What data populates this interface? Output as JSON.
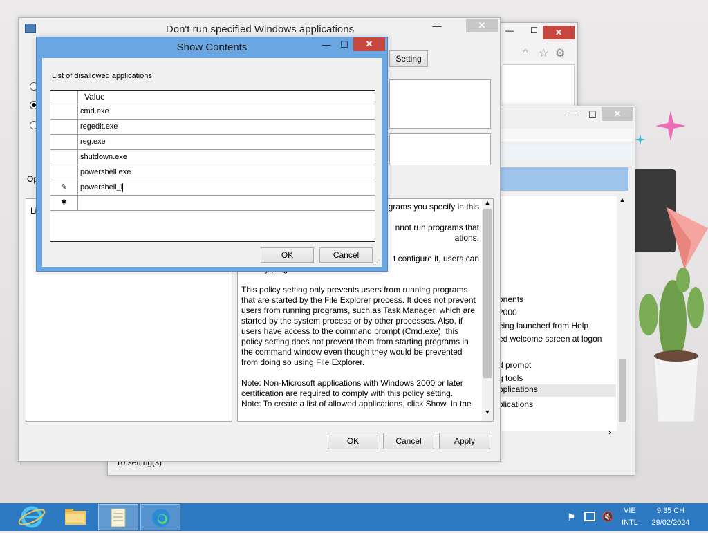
{
  "main_dialog": {
    "title": "Don't run specified Windows applications",
    "setting_button": "Setting",
    "options_label": "Op",
    "list_label_fragment": "Li",
    "help_text_lines": [
      "rograms you specify in this",
      "",
      "nnot run programs that",
      "ations.",
      "",
      "t configure it, users can",
      "run any programs.",
      "",
      "This policy setting only prevents users from running programs",
      "that are started by the File Explorer process. It does not prevent",
      "users from running programs, such as Task Manager, which are",
      "started by the system process or by other processes.  Also, if",
      "users have access to the command prompt (Cmd.exe), this",
      "policy setting does not prevent them from starting programs in",
      "the command window even though they would be prevented",
      "from doing so using File Explorer.",
      "",
      "Note: Non-Microsoft applications with Windows 2000 or later",
      "certification are required to comply with this policy setting.",
      "Note: To create a list of allowed applications, click Show.  In the"
    ],
    "ok_label": "OK",
    "cancel_label": "Cancel",
    "apply_label": "Apply"
  },
  "show_contents": {
    "title": "Show Contents",
    "list_label": "List of disallowed applications",
    "column_header": "Value",
    "rows": [
      "cmd.exe",
      "regedit.exe",
      "reg.exe",
      "shutdown.exe",
      "powershell.exe",
      "powershell_i"
    ],
    "editing_marker": "✎",
    "new_row_marker": "✱",
    "ok_label": "OK",
    "cancel_label": "Cancel"
  },
  "background_editor": {
    "items": [
      "onents",
      "2000",
      "eing launched from Help",
      "ed welcome screen at logon",
      "",
      "d prompt",
      "g tools",
      "pplications",
      "plications"
    ],
    "status": "10 setting(s)"
  },
  "taskbar": {
    "language_top": "VIE",
    "language_bottom": "INTL",
    "time": "9:35 CH",
    "date": "29/02/2024"
  },
  "colors": {
    "accent_blue": "#6aa6e2",
    "close_red": "#c7463e",
    "taskbar": "#2d7ac3",
    "selection": "#9ec4eb"
  }
}
